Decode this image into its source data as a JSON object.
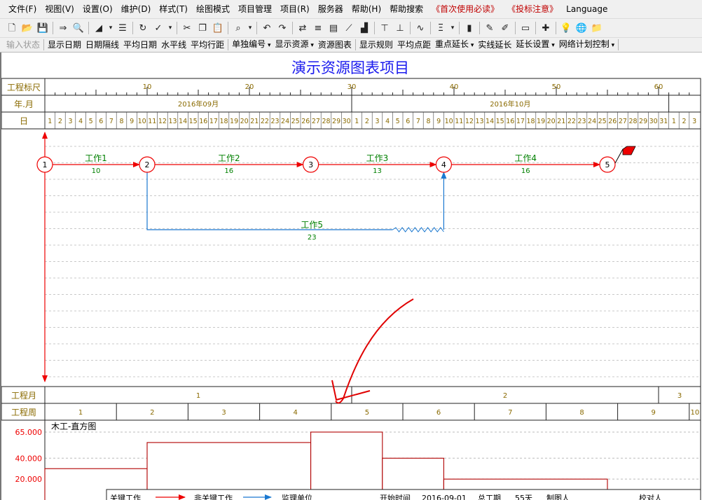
{
  "menu": [
    "文件(F)",
    "视图(V)",
    "设置(O)",
    "维护(D)",
    "样式(T)",
    "绘图模式",
    "项目管理",
    "项目(R)",
    "服务器",
    "帮助(H)",
    "帮助搜索",
    "《首次使用必读》",
    "《投标注意》",
    "Language"
  ],
  "toolbar_icons": [
    "new-icon",
    "open-icon",
    "save-icon",
    "export-icon",
    "print-preview-icon",
    "fill-icon",
    "indent-icon",
    "refresh-icon",
    "check-icon",
    "cut-icon",
    "copy-icon",
    "paste-icon",
    "find-icon",
    "undo-icon",
    "redo-icon",
    "network-icon",
    "bar-icon",
    "table-icon",
    "line-icon",
    "resource-icon",
    "align-top-icon",
    "align-bottom-icon",
    "curve-icon",
    "format-icon",
    "column-chart-icon",
    "draw-icon",
    "edit-icon",
    "monitor-icon",
    "cross-icon",
    "bulb-icon",
    "globe-icon",
    "folder-icon"
  ],
  "toolbar2": [
    {
      "label": "输入状态",
      "disabled": true
    },
    {
      "label": "显示日期"
    },
    {
      "label": "日期隔线"
    },
    {
      "label": "平均日期"
    },
    {
      "label": "水平线"
    },
    {
      "label": "平均行距"
    },
    {
      "label": "单独编号",
      "dropdown": true
    },
    {
      "label": "显示资源",
      "dropdown": true
    },
    {
      "label": "资源图表"
    },
    {
      "label": "显示规则"
    },
    {
      "label": "平均点距"
    },
    {
      "label": "重点延长",
      "dropdown": true
    },
    {
      "label": "实线延长"
    },
    {
      "label": "延长设置",
      "dropdown": true
    },
    {
      "label": "网络计划控制",
      "dropdown": true
    }
  ],
  "title": "演示资源图表项目",
  "colors": {
    "critical": "#ee0000",
    "noncritical": "#1a78d0",
    "text_olive": "#8a6a00",
    "title_blue": "#1a1aee",
    "task_green": "#008000"
  },
  "scale": {
    "label": "工程标尺",
    "ticks": [
      10,
      20,
      30,
      40,
      50,
      60
    ]
  },
  "month_row": {
    "label": "年.月",
    "months": [
      "2016年09月",
      "2016年10月"
    ]
  },
  "day_row": {
    "label": "日",
    "days": [
      1,
      2,
      3,
      4,
      5,
      6,
      7,
      8,
      9,
      10,
      11,
      12,
      13,
      14,
      15,
      16,
      17,
      18,
      19,
      20,
      21,
      22,
      23,
      24,
      25,
      26,
      27,
      28,
      29,
      30,
      1,
      2,
      3,
      4,
      5,
      6,
      7,
      8,
      9,
      10,
      11,
      12,
      13,
      14,
      15,
      16,
      17,
      18,
      19,
      20,
      21,
      22,
      23,
      24,
      25,
      26,
      27,
      28,
      29,
      30,
      31,
      1,
      2,
      3
    ]
  },
  "nodes": [
    {
      "id": "1",
      "day": 1
    },
    {
      "id": "2",
      "day": 11
    },
    {
      "id": "3",
      "day": 27
    },
    {
      "id": "4",
      "day": 40
    },
    {
      "id": "5",
      "day": 56
    }
  ],
  "tasks": [
    {
      "name": "工作1",
      "duration": "10",
      "from": "1",
      "to": "2",
      "critical": true
    },
    {
      "name": "工作2",
      "duration": "16",
      "from": "2",
      "to": "3",
      "critical": true
    },
    {
      "name": "工作3",
      "duration": "13",
      "from": "3",
      "to": "4",
      "critical": true
    },
    {
      "name": "工作4",
      "duration": "16",
      "from": "4",
      "to": "5",
      "critical": true
    },
    {
      "name": "工作5",
      "duration": "23",
      "from": "2",
      "to": "4",
      "critical": false,
      "float_days": 5
    }
  ],
  "project_month": {
    "label": "工程月",
    "values": [
      "1",
      "2",
      "3"
    ]
  },
  "project_week": {
    "label": "工程周",
    "values": [
      "1",
      "2",
      "3",
      "4",
      "5",
      "6",
      "7",
      "8",
      "9",
      "10"
    ]
  },
  "histogram": {
    "title": "木工-直方图",
    "yticks": [
      "65.000",
      "40.000",
      "20.000"
    ],
    "ytick_values": [
      65,
      40,
      20
    ],
    "segments": [
      {
        "start_day": 1,
        "end_day": 11,
        "value": 30
      },
      {
        "start_day": 11,
        "end_day": 27,
        "value": 55
      },
      {
        "start_day": 27,
        "end_day": 34,
        "value": 65
      },
      {
        "start_day": 34,
        "end_day": 40,
        "value": 40
      },
      {
        "start_day": 40,
        "end_day": 56,
        "value": 20
      }
    ]
  },
  "legend": [
    "关键工作",
    "非关键工作",
    "监理单位",
    "开始时间",
    "2016-09-01",
    "总工期",
    "55天",
    "制图人",
    "校对人"
  ]
}
